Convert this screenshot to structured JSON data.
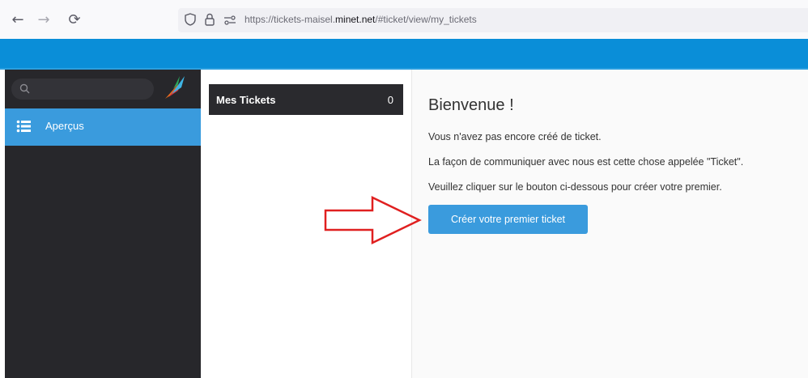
{
  "browser": {
    "back_icon": "←",
    "forward_icon": "→",
    "reload_icon": "⟳",
    "url_prefix": "https://tickets-maisel.",
    "url_host": "minet.net",
    "url_path": "/#ticket/view/my_tickets"
  },
  "sidebar": {
    "search_placeholder": "",
    "items": [
      {
        "label": "Aperçus",
        "icon": "list-icon"
      }
    ]
  },
  "overviews": [
    {
      "name": "Mes Tickets",
      "count": "0"
    }
  ],
  "main": {
    "title": "Bienvenue !",
    "paragraphs": [
      "Vous n'avez pas encore créé de ticket.",
      "La façon de communiquer avec nous est cette chose appelée \"Ticket\".",
      "Veuillez cliquer sur le bouton ci-dessous pour créer votre premier."
    ],
    "create_button": "Créer votre premier ticket"
  },
  "colors": {
    "header_blue": "#0a8ed8",
    "accent_blue": "#3a9bdd",
    "sidebar_dark": "#27272b",
    "arrow_red": "#e02020"
  }
}
